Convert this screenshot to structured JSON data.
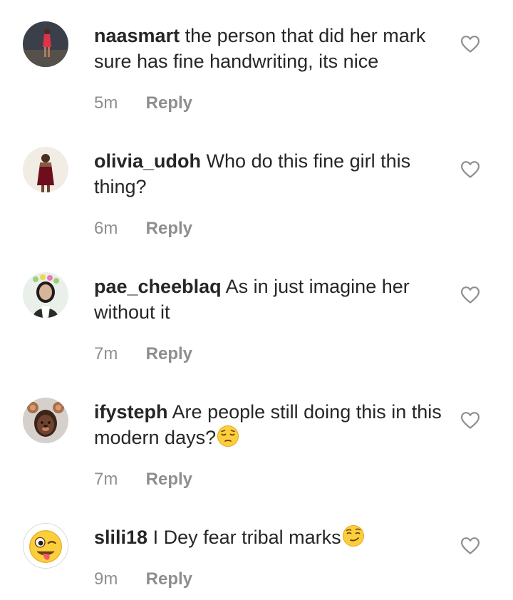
{
  "comments": [
    {
      "username": "naasmart",
      "text": "the person that did her mark sure has fine handwriting, its nice",
      "time": "5m",
      "reply_label": "Reply",
      "emoji": ""
    },
    {
      "username": "olivia_udoh",
      "text": "Who do this fine girl this thing?",
      "time": "6m",
      "reply_label": "Reply",
      "emoji": ""
    },
    {
      "username": "pae_cheeblaq",
      "text": "As in just imagine her without it",
      "time": "7m",
      "reply_label": "Reply",
      "emoji": ""
    },
    {
      "username": "ifysteph",
      "text": "Are people still doing this in this modern days?",
      "time": "7m",
      "reply_label": "Reply",
      "emoji": "pensive-face"
    },
    {
      "username": "slili18",
      "text": "I Dey fear tribal marks",
      "time": "9m",
      "reply_label": "Reply",
      "emoji": "smirking-face"
    }
  ],
  "icons": {
    "like": "heart-outline-icon"
  },
  "colors": {
    "text": "#262626",
    "secondary": "#8e8e8e",
    "heart_stroke": "#8e8e8e"
  }
}
